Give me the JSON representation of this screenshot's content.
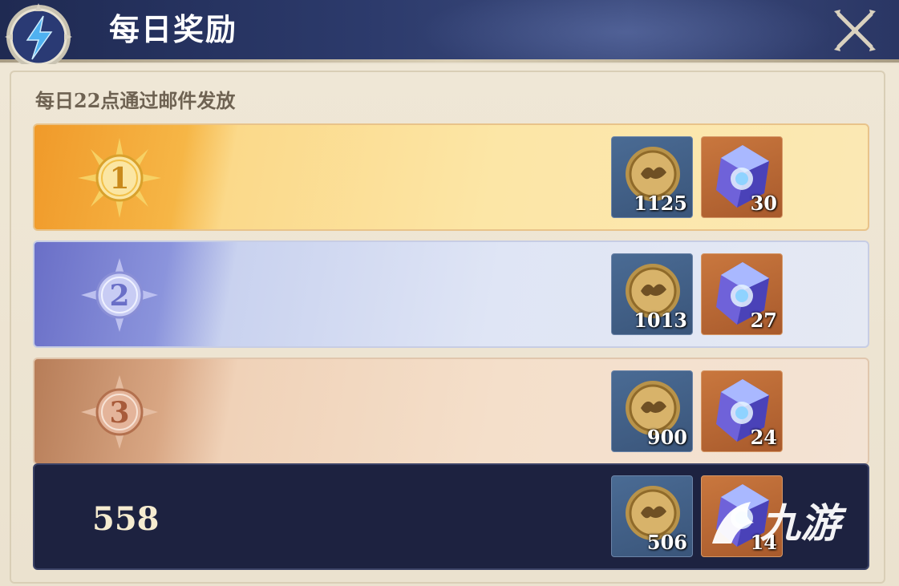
{
  "header": {
    "title": "每日奖励",
    "emblem_icon": "lightning-emblem-icon",
    "close_icon": "close-x-icon"
  },
  "panel": {
    "subtitle": "每日22点通过邮件发放"
  },
  "ranks": [
    {
      "rank": "1",
      "medal_color": "#f2c14a",
      "rewards": [
        {
          "type": "coin",
          "icon": "coin-icon",
          "qty": "1125"
        },
        {
          "type": "crystal",
          "icon": "crystal-icon",
          "qty": "30"
        }
      ]
    },
    {
      "rank": "2",
      "medal_color": "#a5a9e6",
      "rewards": [
        {
          "type": "coin",
          "icon": "coin-icon",
          "qty": "1013"
        },
        {
          "type": "crystal",
          "icon": "crystal-icon",
          "qty": "27"
        }
      ]
    },
    {
      "rank": "3",
      "medal_color": "#d79b7b",
      "rewards": [
        {
          "type": "coin",
          "icon": "coin-icon",
          "qty": "900"
        },
        {
          "type": "crystal",
          "icon": "crystal-icon",
          "qty": "24"
        }
      ]
    }
  ],
  "self_row": {
    "score": "558",
    "rewards": [
      {
        "type": "coin",
        "icon": "coin-icon",
        "qty": "506"
      },
      {
        "type": "crystal",
        "icon": "crystal-icon",
        "qty": "14"
      }
    ]
  },
  "watermark": {
    "text": "九游",
    "icon": "jiuyou-logo-icon"
  },
  "colors": {
    "header_bg": "#2c3a6b",
    "panel_bg": "#ebe2cf",
    "self_row_bg": "#1d2240",
    "accent_gold": "#f2c14a"
  }
}
